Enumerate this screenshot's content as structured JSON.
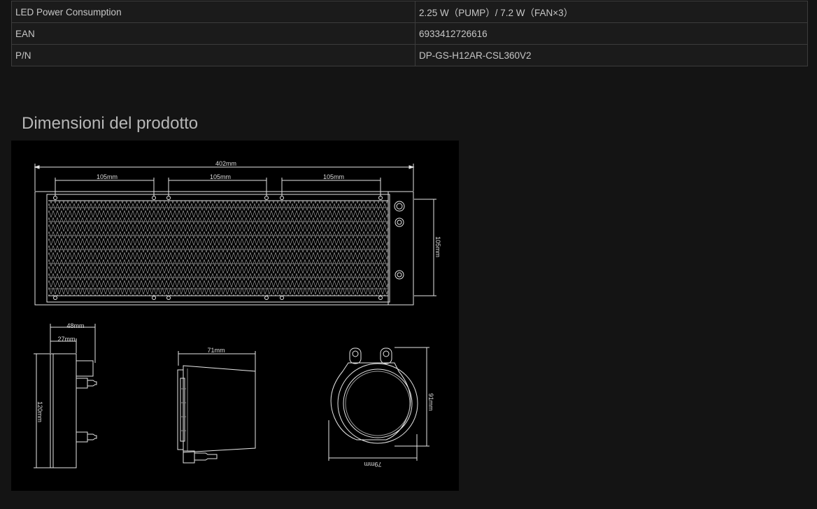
{
  "specs": [
    {
      "label": "LED Power Consumption",
      "value": "2.25 W（PUMP）/ 7.2 W（FAN×3）"
    },
    {
      "label": "EAN",
      "value": "6933412726616"
    },
    {
      "label": "P/N",
      "value": "DP-GS-H12AR-CSL360V2"
    }
  ],
  "section": {
    "title": "Dimensioni del prodotto"
  },
  "drawing": {
    "width_total": "402mm",
    "fan_spacing": [
      "105mm",
      "105mm",
      "105mm"
    ],
    "radiator_height": "105mm",
    "side_width": "48mm",
    "side_thickness": "27mm",
    "side_height": "120mm",
    "pump_depth": "71mm",
    "pump_height": "91mm",
    "pump_width": "79mm"
  }
}
